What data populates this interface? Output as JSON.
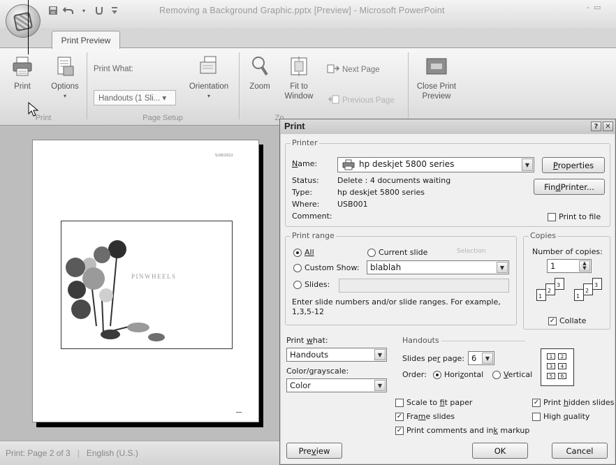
{
  "window": {
    "title": "Removing a Background Graphic.pptx [Preview] - Microsoft PowerPoint",
    "controls": [
      "-",
      "▭"
    ]
  },
  "qat": {
    "save": "save-icon",
    "undo": "undo-icon",
    "redo": "redo-icon",
    "more": "▼"
  },
  "ribbon": {
    "tab": "Print Preview",
    "print_label": "Print",
    "options_label": "Options",
    "print_what_label": "Print What:",
    "print_what_value": "Handouts (1 Sli... ▾",
    "orientation_label": "Orientation",
    "zoom_label": "Zoom",
    "fit_window_label": "Fit to Window",
    "next_page_label": "Next Page",
    "previous_page_label": "Previous Page",
    "close_preview_label": "Close Print Preview",
    "group_print": "Print",
    "group_page_setup": "Page Setup",
    "group_zoom": "Zo"
  },
  "preview": {
    "date": "5/28/2022",
    "slide_title": "PINWHEELS"
  },
  "status": {
    "page": "Print: Page 2 of 3",
    "language": "English (U.S.)"
  },
  "dialog": {
    "title": "Print",
    "help_btn": "?",
    "close_btn": "✕",
    "printer": {
      "group": "Printer",
      "name_label": "Name:",
      "name_value": "hp deskjet 5800 series",
      "status_label": "Status:",
      "status_value": "Delete : 4 documents waiting",
      "type_label": "Type:",
      "type_value": "hp deskjet 5800 series",
      "where_label": "Where:",
      "where_value": "USB001",
      "comment_label": "Comment:",
      "properties_btn": "Properties",
      "find_printer_btn": "Find Printer...",
      "print_to_file": "Print to file"
    },
    "print_range": {
      "group": "Print range",
      "all": "All",
      "current_slide": "Current slide",
      "selection": "Selection",
      "custom_show": "Custom Show:",
      "custom_show_value": "blablah",
      "slides": "Slides:",
      "hint": "Enter slide numbers and/or slide ranges. For example, 1,3,5-12"
    },
    "copies": {
      "group": "Copies",
      "number_label": "Number of copies:",
      "number_value": "1",
      "collate": "Collate",
      "collate_checked": true
    },
    "print_what": {
      "label": "Print what:",
      "value": "Handouts"
    },
    "color": {
      "label": "Color/grayscale:",
      "value": "Color"
    },
    "handouts": {
      "group": "Handouts",
      "slides_per_page_label": "Slides per page:",
      "slides_per_page_value": "6",
      "order_label": "Order:",
      "horizontal": "Horizontal",
      "vertical": "Vertical",
      "layout_numbers": [
        "1",
        "2",
        "3",
        "4",
        "5",
        "6"
      ]
    },
    "options": {
      "scale_to_fit": "Scale to fit paper",
      "frame_slides": "Frame slides",
      "print_comments": "Print comments and ink markup",
      "print_hidden": "Print hidden slides",
      "high_quality": "High quality"
    },
    "buttons": {
      "preview": "Preview",
      "ok": "OK",
      "cancel": "Cancel"
    }
  }
}
